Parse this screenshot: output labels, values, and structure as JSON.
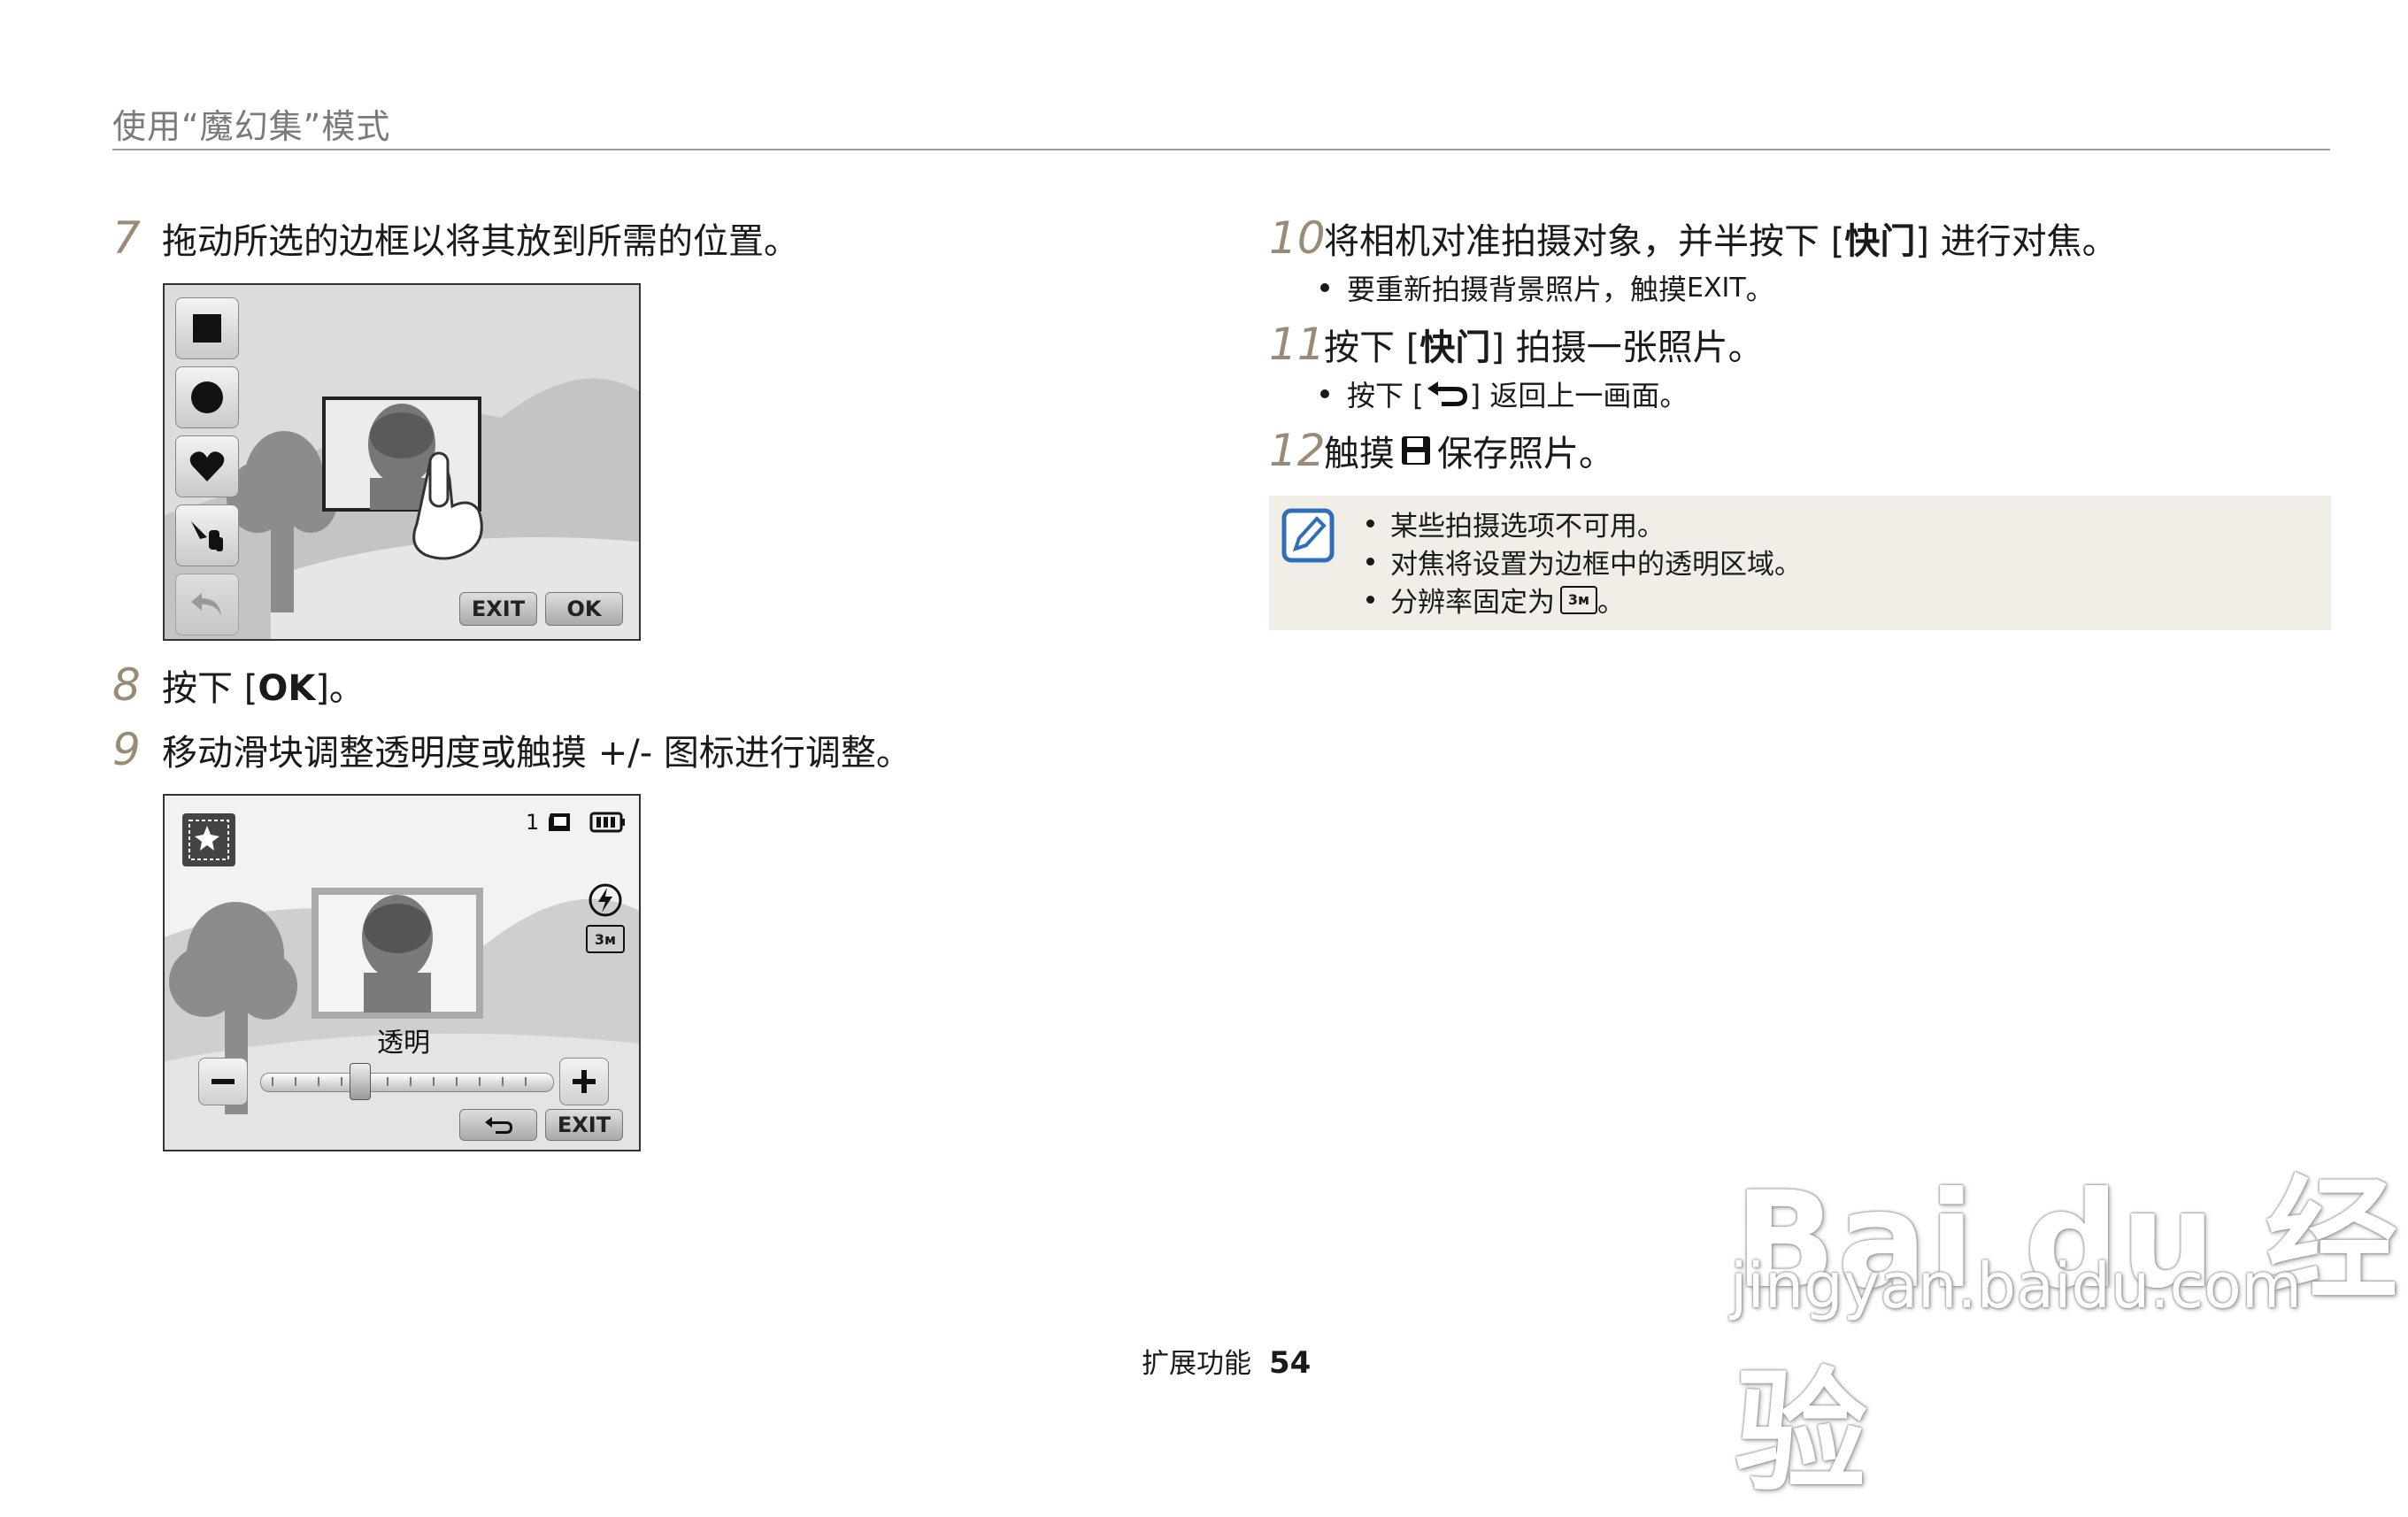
{
  "header": {
    "title": "使用“魔幻集”模式"
  },
  "left_steps": [
    {
      "num": "7",
      "text": "拖动所选的边框以将其放到所需的位置。"
    },
    {
      "num": "8",
      "text_pre": "按下 [",
      "text_key": "OK",
      "text_post": "]。"
    },
    {
      "num": "9",
      "text": "移动滑块调整透明度或触摸 +/- 图标进行调整。"
    }
  ],
  "screen1": {
    "exit_label": "EXIT",
    "ok_label": "OK"
  },
  "screen2": {
    "shot_count": "1",
    "slider_label": "透明",
    "exit_label": "EXIT",
    "transparency_level": 0.33
  },
  "right_steps": [
    {
      "num": "10",
      "text_pre": "将相机对准拍摄对象，并半按下 [",
      "text_key": "快门",
      "text_post": "] 进行对焦。",
      "bullet_pre": "要重新拍摄背景照片，触摸 ",
      "bullet_key": "EXIT",
      "bullet_post": "。"
    },
    {
      "num": "11",
      "text_pre": "按下 [",
      "text_key": "快门",
      "text_post": "] 拍摄一张照片。",
      "bullet_pre": "按下 [",
      "bullet_post": "] 返回上一画面。"
    },
    {
      "num": "12",
      "text_pre": "触摸 ",
      "text_post": " 保存照片。"
    }
  ],
  "note": {
    "items": [
      "某些拍摄选项不可用。",
      "对焦将设置为边框中的透明区域。",
      "分辨率固定为 "
    ],
    "resolution_suffix": "。"
  },
  "footer": {
    "section": "扩展功能",
    "page": "54"
  },
  "watermark": {
    "logo_text": "Bai du 经验",
    "url": "jingyan.baidu.com"
  }
}
